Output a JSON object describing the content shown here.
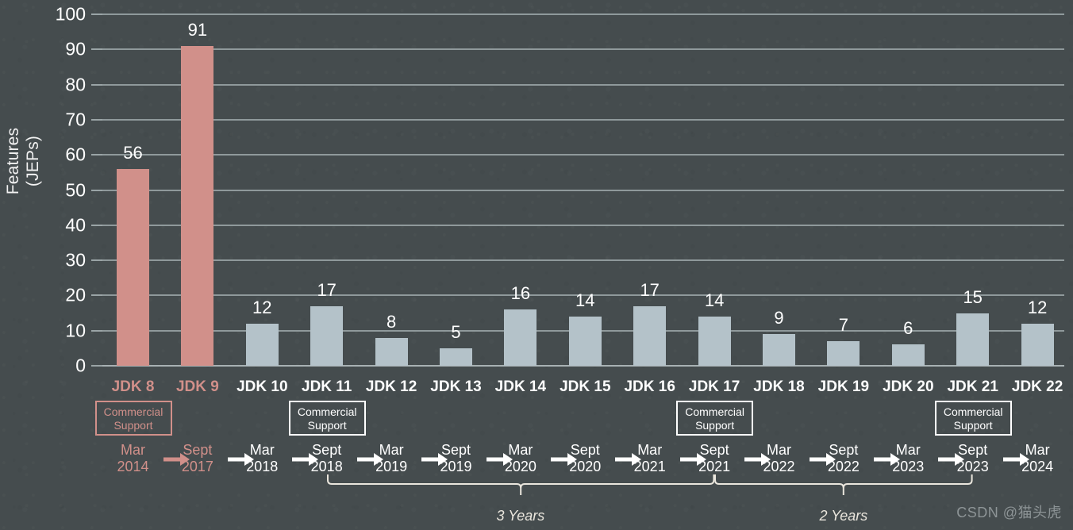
{
  "chart_data": {
    "type": "bar",
    "title": "",
    "xlabel": "",
    "ylabel": "Features\n(JEPs)",
    "ylabel_lines": [
      "Features",
      "(JEPs)"
    ],
    "ylim": [
      0,
      100
    ],
    "ytick_step": 10,
    "yticks": [
      0,
      10,
      20,
      30,
      40,
      50,
      60,
      70,
      80,
      90,
      100
    ],
    "grid": true,
    "legend": "none",
    "categories": [
      "JDK 8",
      "JDK 9",
      "JDK 10",
      "JDK 11",
      "JDK 12",
      "JDK 13",
      "JDK 14",
      "JDK 15",
      "JDK 16",
      "JDK 17",
      "JDK 18",
      "JDK 19",
      "JDK 20",
      "JDK 21",
      "JDK 22"
    ],
    "values": [
      56,
      91,
      12,
      17,
      8,
      5,
      16,
      14,
      17,
      14,
      9,
      7,
      6,
      15,
      12
    ],
    "bar_colors": [
      "#d1908a",
      "#d1908a",
      "#b4c2c9",
      "#b4c2c9",
      "#b4c2c9",
      "#b4c2c9",
      "#b4c2c9",
      "#b4c2c9",
      "#b4c2c9",
      "#b4c2c9",
      "#b4c2c9",
      "#b4c2c9",
      "#b4c2c9",
      "#b4c2c9",
      "#b4c2c9"
    ],
    "category_label_colors": [
      "#d1908a",
      "#d1908a",
      "#ffffff",
      "#ffffff",
      "#ffffff",
      "#ffffff",
      "#ffffff",
      "#ffffff",
      "#ffffff",
      "#ffffff",
      "#ffffff",
      "#ffffff",
      "#ffffff",
      "#ffffff",
      "#ffffff"
    ],
    "release_dates": [
      {
        "month": "Mar",
        "year": "2014",
        "color": "#d1908a"
      },
      {
        "month": "Sept",
        "year": "2017",
        "color": "#d1908a"
      },
      {
        "month": "Mar",
        "year": "2018",
        "color": "#ffffff"
      },
      {
        "month": "Sept",
        "year": "2018",
        "color": "#ffffff"
      },
      {
        "month": "Mar",
        "year": "2019",
        "color": "#ffffff"
      },
      {
        "month": "Sept",
        "year": "2019",
        "color": "#ffffff"
      },
      {
        "month": "Mar",
        "year": "2020",
        "color": "#ffffff"
      },
      {
        "month": "Sept",
        "year": "2020",
        "color": "#ffffff"
      },
      {
        "month": "Mar",
        "year": "2021",
        "color": "#ffffff"
      },
      {
        "month": "Sept",
        "year": "2021",
        "color": "#ffffff"
      },
      {
        "month": "Mar",
        "year": "2022",
        "color": "#ffffff"
      },
      {
        "month": "Sept",
        "year": "2022",
        "color": "#ffffff"
      },
      {
        "month": "Mar",
        "year": "2023",
        "color": "#ffffff"
      },
      {
        "month": "Sept",
        "year": "2023",
        "color": "#ffffff"
      },
      {
        "month": "Mar",
        "year": "2024",
        "color": "#ffffff"
      }
    ],
    "annotations": {
      "commercial_support": [
        {
          "label": "Commercial\nSupport",
          "for": "JDK 8",
          "color": "#d1908a"
        },
        {
          "label": "Commercial\nSupport",
          "for": "JDK 11",
          "color": "#ffffff"
        },
        {
          "label": "Commercial\nSupport",
          "for": "JDK 17",
          "color": "#ffffff"
        },
        {
          "label": "Commercial\nSupport",
          "for": "JDK 21",
          "color": "#ffffff"
        }
      ],
      "brackets": [
        {
          "label": "3 Years",
          "from": "Sept 2018",
          "to": "Sept 2021"
        },
        {
          "label": "2 Years",
          "from": "Sept 2021",
          "to": "Sept 2023"
        }
      ]
    }
  },
  "ytick_labels": [
    "100",
    "90",
    "80",
    "70",
    "60",
    "50",
    "40",
    "30",
    "20",
    "10",
    "0"
  ],
  "watermark": {
    "text": "CSDN @猫头虎"
  }
}
